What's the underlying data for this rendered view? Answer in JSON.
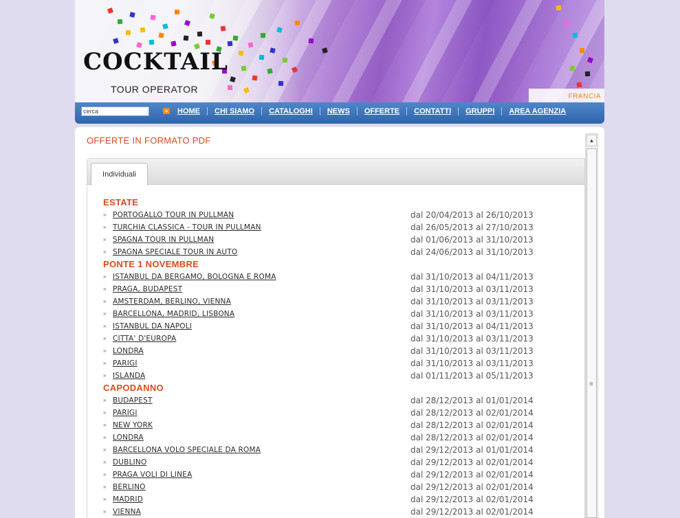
{
  "header": {
    "logo_text": "COCKTAIL",
    "logo_subtitle": "TOUR OPERATOR",
    "country": "FRANCIA"
  },
  "nav": {
    "search_value": "cerca",
    "go_glyph": "»",
    "items": [
      "HOME",
      "CHI SIAMO",
      "CATALOGHI",
      "NEWS",
      "OFFERTE",
      "CONTATTI",
      "GRUPPI",
      "AREA AGENZIA"
    ]
  },
  "page_title": "OFFERTE IN FORMATO PDF",
  "tabs": [
    {
      "label": "Individuali"
    }
  ],
  "sections": [
    {
      "title": "ESTATE",
      "rows": [
        {
          "label": "PORTOGALLO TOUR IN PULLMAN",
          "dates": "dal 20/04/2013 al 26/10/2013"
        },
        {
          "label": "TURCHIA CLASSICA - TOUR IN PULLMAN",
          "dates": "dal 26/05/2013 al 27/10/2013"
        },
        {
          "label": "SPAGNA TOUR IN PULLMAN",
          "dates": "dal 01/06/2013 al 31/10/2013"
        },
        {
          "label": "SPAGNA SPECIALE TOUR IN AUTO",
          "dates": "dal 24/06/2013 al 31/10/2013"
        }
      ]
    },
    {
      "title": "PONTE 1 NOVEMBRE",
      "rows": [
        {
          "label": "ISTANBUL DA BERGAMO, BOLOGNA E ROMA",
          "dates": "dal 31/10/2013 al 04/11/2013"
        },
        {
          "label": "PRAGA, BUDAPEST",
          "dates": "dal 31/10/2013 al 03/11/2013"
        },
        {
          "label": "AMSTERDAM, BERLINO, VIENNA",
          "dates": "dal 31/10/2013 al 03/11/2013"
        },
        {
          "label": "BARCELLONA, MADRID, LISBONA",
          "dates": "dal 31/10/2013 al 03/11/2013"
        },
        {
          "label": "ISTANBUL DA NAPOLI",
          "dates": "dal 31/10/2013 al 04/11/2013"
        },
        {
          "label": "CITTA' D'EUROPA",
          "dates": "dal 31/10/2013 al 03/11/2013"
        },
        {
          "label": "LONDRA",
          "dates": "dal 31/10/2013 al 03/11/2013"
        },
        {
          "label": "PARIGI",
          "dates": "dal 31/10/2013 al 03/11/2013"
        },
        {
          "label": "ISLANDA",
          "dates": "dal 01/11/2013 al 05/11/2013"
        }
      ]
    },
    {
      "title": "CAPODANNO",
      "rows": [
        {
          "label": "BUDAPEST",
          "dates": "dal 28/12/2013 al 01/01/2014"
        },
        {
          "label": "PARIGI",
          "dates": "dal 28/12/2013 al 02/01/2014"
        },
        {
          "label": "NEW YORK",
          "dates": "dal 28/12/2013 al 02/01/2014"
        },
        {
          "label": "LONDRA",
          "dates": "dal 28/12/2013 al 02/01/2014"
        },
        {
          "label": "BARCELLONA VOLO SPECIALE DA ROMA",
          "dates": "dal 29/12/2013 al 01/01/2014"
        },
        {
          "label": "DUBLINO",
          "dates": "dal 29/12/2013 al 02/01/2014"
        },
        {
          "label": "PRAGA VOLI DI LINEA",
          "dates": "dal 29/12/2013 al 02/01/2014"
        },
        {
          "label": "BERLINO",
          "dates": "dal 29/12/2013 al 02/01/2014"
        },
        {
          "label": "MADRID",
          "dates": "dal 29/12/2013 al 02/01/2014"
        },
        {
          "label": "VIENNA",
          "dates": "dal 29/12/2013 al 02/01/2014"
        }
      ]
    }
  ],
  "colors": {
    "accent": "#d84b1d",
    "nav_blue": "#2f64ab",
    "country": "#e28a1c",
    "background": "#dedcee"
  },
  "icons": {
    "bullet": "double-chevron-icon",
    "scroll_up": "scroll-up-arrow-icon",
    "search_go": "search-go-icon"
  }
}
